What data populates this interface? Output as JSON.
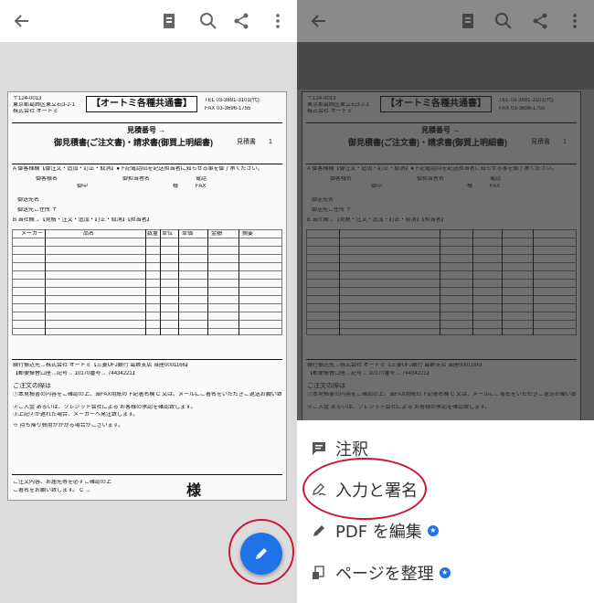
{
  "colors": {
    "accent": "#1e73e6",
    "highlight_circle": "#c9183b"
  },
  "toolbar": {
    "back_icon": "arrow-left-icon",
    "icons": [
      "document-view-icon",
      "search-icon",
      "share-icon",
      "more-vert-icon"
    ]
  },
  "document": {
    "postal": "〒124-0013",
    "address": "東京都葛飾区東立石3-2-1",
    "company": "株式会社 オートミ",
    "title": "【オートミ各種共通書】",
    "tel": "TEL 03-3691-3101(代)",
    "fax": "FAX 03-3696-1755",
    "quote_no": "見積番号 →",
    "heading": "御見積書(ご注文書)・請求書(御買上明細書)",
    "mitsumori": "見積書",
    "page": "1",
    "instruction": "A 御客様欄【御注文・追加・訂正・取消】●下記電話noを記送担当者に知らせる事を御了承ください。",
    "customer_name": "御客様名",
    "goto": "御中",
    "tantou": "御担当者名",
    "denwa": "電話",
    "fax_label": "FAX",
    "sama": "様",
    "sender": "御送先名",
    "address_label": "御送先ご住所 〒",
    "order_row": "B 当社欄→【見積・注文・追加・訂正・取消】【担当者】",
    "col_maker": "メーカー",
    "col_item": "品名",
    "col_qty": "数量",
    "col_unit": "単位",
    "col_price": "単価",
    "col_amount": "金額",
    "col_note": "摘要",
    "bank": "銀行振込先→株式会社 オートミ【三菱UFJ銀行 葛飾支店 当座0001166】",
    "bank2": "【郵便振替口座→記号→ 10170番号→ 74434221】",
    "notice_head": "ご注文の際は",
    "notice1": "①本見積書の内容をご確認の上、当FAX用紙の下記署名欄 C 又は、メールにご署名をいただきご返送お願い致します。",
    "notice2": "②ご入金 あるいは、クレジット会社による お客様の承認を確認致します。",
    "notice3": "③上記②が遅れた場合、メーカーへ発注致します。",
    "notice4": "※ 持ち帰り費用がかかる場合がございます。",
    "bottom_left": "ご注文内容、お届先等を必ずご確認の上",
    "bottom_left2": "ご署名をお願い致します。 C →",
    "big_sama": "様"
  },
  "menu": {
    "items": [
      {
        "label": "注釈",
        "icon": "comment-icon",
        "badge": false
      },
      {
        "label": "入力と署名",
        "icon": "signature-pen-icon",
        "badge": false
      },
      {
        "label": "PDF を編集",
        "icon": "edit-pencil-icon",
        "badge": true
      },
      {
        "label": "ページを整理",
        "icon": "organize-pages-icon",
        "badge": true
      }
    ]
  },
  "fab": {
    "icon": "pencil-icon"
  }
}
